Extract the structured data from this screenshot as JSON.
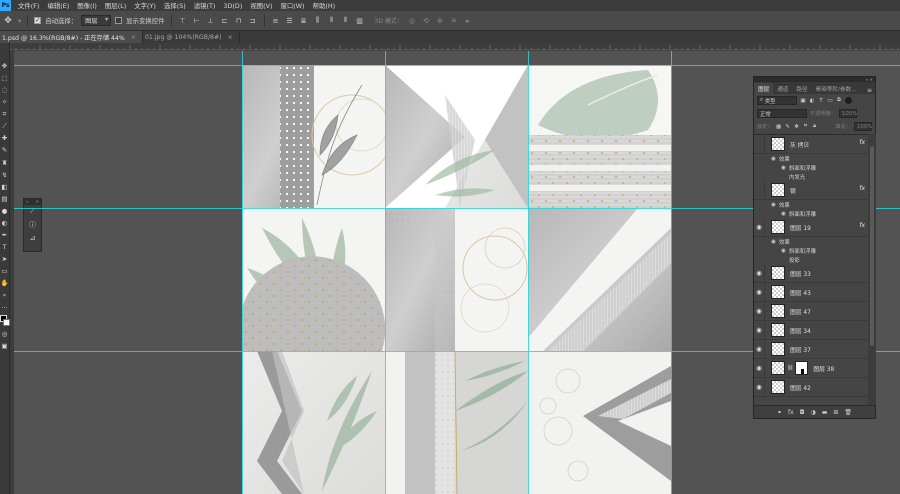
{
  "menubar": {
    "app_icon": "Ps",
    "items": [
      "文件(F)",
      "编辑(E)",
      "图像(I)",
      "图层(L)",
      "文字(Y)",
      "选择(S)",
      "滤镜(T)",
      "3D(D)",
      "视图(V)",
      "窗口(W)",
      "帮助(H)"
    ]
  },
  "options": {
    "tool_icon": "move-icon",
    "auto_select_label": "自动选择：",
    "auto_select_value": "图层",
    "transform_label": "显示变换控件",
    "mode_3d_label": "3D 模式："
  },
  "tabs": [
    {
      "label": "1.psd @ 16.3%(RGB/8#) - 正在存储 44%",
      "active": true
    },
    {
      "label": "01.jpg @ 104%(RGB/8#)",
      "active": false
    }
  ],
  "layers_panel": {
    "tabs": [
      "图层",
      "通道",
      "路径",
      "晕染等阶/参数..."
    ],
    "filter_kind": "类型",
    "blend_mode": "正常",
    "opacity_label": "不透明度：",
    "opacity_value": "100%",
    "lock_label": "锁定：",
    "fill_label": "填充：",
    "fill_value": "100%",
    "layers": [
      {
        "name": "灰 拷贝",
        "visible": false,
        "fx": true,
        "effects_label": "效果",
        "effects": [
          "斜面和浮雕",
          "内发光"
        ]
      },
      {
        "name": "银",
        "visible": false,
        "fx": true,
        "effects_label": "效果",
        "effects": [
          "斜面和浮雕"
        ]
      },
      {
        "name": "图层 19",
        "visible": true,
        "fx": true,
        "effects_label": "效果",
        "effects": [
          "斜面和浮雕",
          "投影"
        ]
      },
      {
        "name": "图层 33",
        "visible": true,
        "fx": false
      },
      {
        "name": "图层 43",
        "visible": true,
        "fx": false
      },
      {
        "name": "图层 47",
        "visible": true,
        "fx": false
      },
      {
        "name": "图层 34",
        "visible": true,
        "fx": false
      },
      {
        "name": "图层 37",
        "visible": true,
        "fx": false
      },
      {
        "name": "图层 38",
        "visible": true,
        "fx": false,
        "mask": true
      },
      {
        "name": "图层 42",
        "visible": true,
        "fx": false
      }
    ]
  }
}
